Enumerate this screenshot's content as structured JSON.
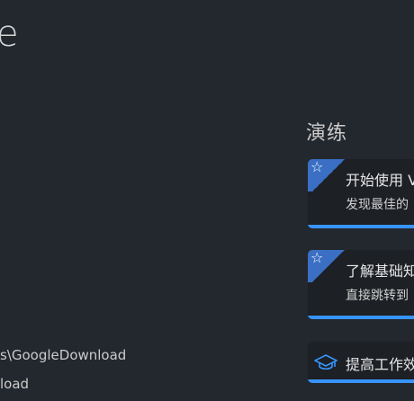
{
  "left": {
    "title_fragment": "e",
    "recent": [
      {
        "path": "s\\GoogleDownload"
      },
      {
        "path": "load"
      }
    ]
  },
  "walkthroughs": {
    "heading": "演练",
    "items": [
      {
        "title": "开始使用 V",
        "desc": "发现最佳的",
        "icon": "star-icon"
      },
      {
        "title": "了解基础知",
        "desc": "直接跳转到",
        "icon": "star-icon"
      },
      {
        "title": "提高工作效",
        "desc": "",
        "icon": "graduation-cap-icon"
      }
    ]
  },
  "colors": {
    "background": "#23272e",
    "card": "#1d2025",
    "accent": "#3794ff",
    "ribbon": "#3a6fc4"
  }
}
